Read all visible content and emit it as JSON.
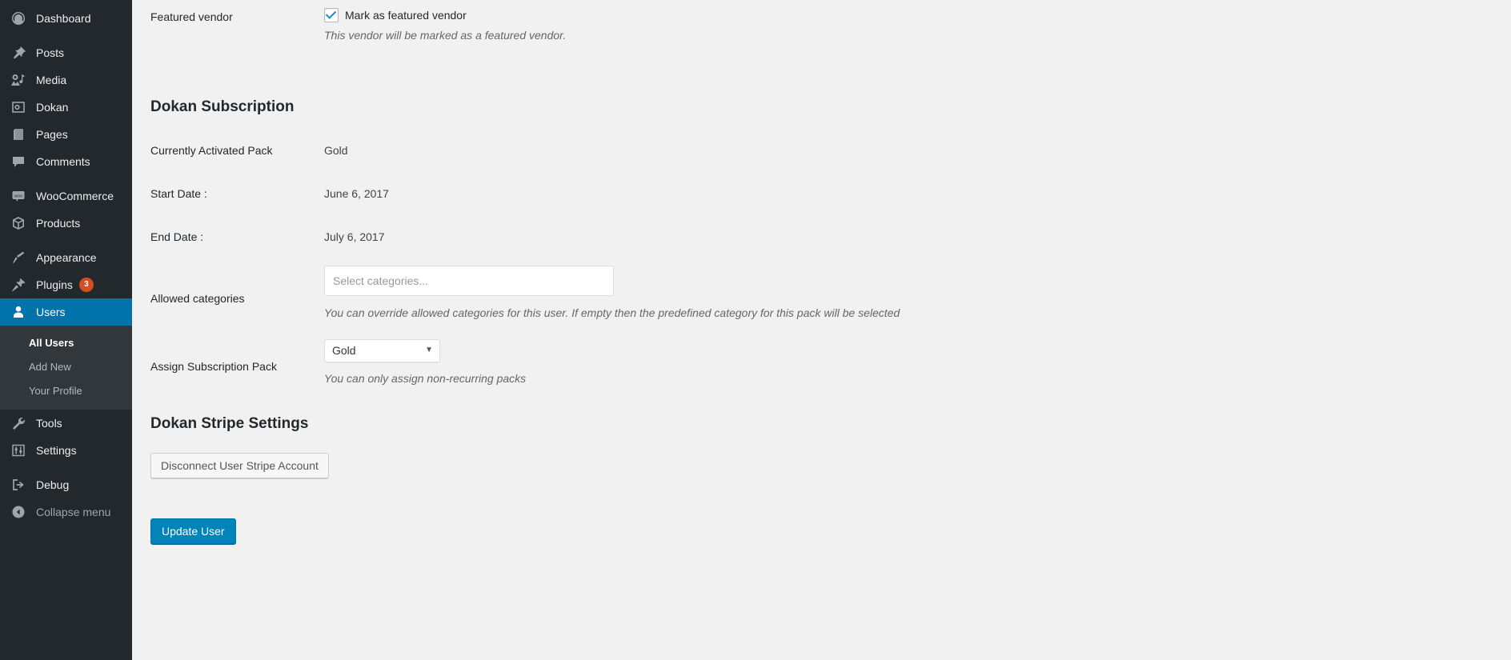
{
  "sidebar": {
    "items": [
      {
        "label": "Dashboard",
        "icon": "dashboard-icon",
        "name": "dashboard"
      },
      {
        "label": "Posts",
        "icon": "pin-icon",
        "name": "posts"
      },
      {
        "label": "Media",
        "icon": "media-icon",
        "name": "media"
      },
      {
        "label": "Dokan",
        "icon": "dokan-icon",
        "name": "dokan"
      },
      {
        "label": "Pages",
        "icon": "pages-icon",
        "name": "pages"
      },
      {
        "label": "Comments",
        "icon": "comment-icon",
        "name": "comments"
      },
      {
        "label": "WooCommerce",
        "icon": "woo-icon",
        "name": "woocommerce"
      },
      {
        "label": "Products",
        "icon": "box-icon",
        "name": "products"
      },
      {
        "label": "Appearance",
        "icon": "brush-icon",
        "name": "appearance"
      },
      {
        "label": "Plugins",
        "icon": "plug-icon",
        "name": "plugins",
        "badge": "3"
      },
      {
        "label": "Users",
        "icon": "user-icon",
        "name": "users",
        "current": true
      },
      {
        "label": "Tools",
        "icon": "wrench-icon",
        "name": "tools"
      },
      {
        "label": "Settings",
        "icon": "sliders-icon",
        "name": "settings"
      },
      {
        "label": "Debug",
        "icon": "exit-icon",
        "name": "debug"
      }
    ],
    "submenu": [
      {
        "label": "All Users",
        "current": true
      },
      {
        "label": "Add New",
        "current": false
      },
      {
        "label": "Your Profile",
        "current": false
      }
    ],
    "collapse": {
      "label": "Collapse menu",
      "icon": "collapse-arrow-icon"
    },
    "accent_color": "#0073aa",
    "background_color": "#23282d",
    "badge_color": "#d54e21"
  },
  "main": {
    "featured_vendor": {
      "label": "Featured vendor",
      "checkbox_label": "Mark as featured vendor",
      "checked": true,
      "description": "This vendor will be marked as a featured vendor."
    },
    "subscription": {
      "heading": "Dokan Subscription",
      "rows": [
        {
          "label": "Currently Activated Pack",
          "value": "Gold"
        },
        {
          "label": "Start Date :",
          "value": "June 6, 2017"
        },
        {
          "label": "End Date :",
          "value": "July 6, 2017"
        }
      ],
      "allowed_categories": {
        "label": "Allowed categories",
        "placeholder": "Select categories...",
        "value": "",
        "description": "You can override allowed categories for this user. If empty then the predefined category for this pack will be selected"
      },
      "assign_pack": {
        "label": "Assign Subscription Pack",
        "selected": "Gold",
        "options": [
          "Gold"
        ],
        "description": "You can only assign non-recurring packs"
      }
    },
    "stripe": {
      "heading": "Dokan Stripe Settings",
      "disconnect_button": "Disconnect User Stripe Account"
    },
    "submit": {
      "update_button": "Update User",
      "color": "#0085ba"
    }
  }
}
